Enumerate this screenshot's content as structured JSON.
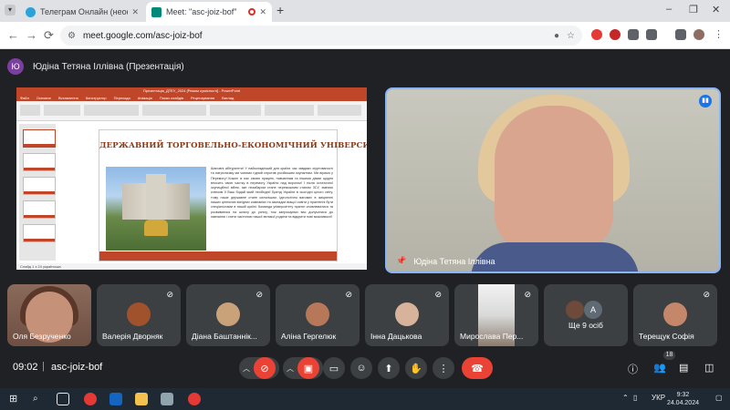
{
  "browser": {
    "tabs": [
      {
        "title": "Телеграм Онлайн (неофіційни",
        "active": false
      },
      {
        "title": "Meet: \"asc-joiz-bof\"",
        "active": true
      }
    ],
    "new_tab": "+",
    "window_controls": {
      "minimize": "–",
      "restore": "❐",
      "close": "✕"
    },
    "nav": {
      "back": "←",
      "forward": "→",
      "reload": "⟳"
    },
    "url": "meet.google.com/asc-joiz-bof"
  },
  "meet": {
    "presenter": {
      "avatar_letter": "Ю",
      "label": "Юдіна Тетяна Іллівна (Презентація)"
    },
    "slide": {
      "app_title": "Презентація_ДТЕУ_2024 [Режим сумісності] - PowerPoint",
      "menu": [
        "Файл",
        "Основне",
        "Вставлення",
        "Конструктор",
        "Переходи",
        "Анімація",
        "Показ слайдів",
        "Рецензування",
        "Вигляд"
      ],
      "heading": "ДЕРЖАВНИЙ ТОРГОВЕЛЬНО-ЕКОНОМІЧНИЙ УНІВЕРСИТЕТ",
      "body": "Шановні абітурієнти! У найскладніший для країни час завдяки згуртованості та патріотизму ми чинимо гідний спротив російським окупантам. Ми віримо у Перемогу! Кожен із нас своєю працею, навчанням та іншими діями щодня вносить свою частку в перемогу України над ворогом! І після остаточної окупаційної війни, яке незабаром стане переможним станом ЗСУ, змінюю ключові її Ваш бодай який необхідні! Бренд України в сьогодні цілого світу, тому наше державне стане сильнішим. Ідеологічно вагомих в зміцненні наших ціннісних вигідних компаніях та закладах вищої освіти у прагненні бути спеціалістами в нашій країні. Команда університету прагне оновлюватися та розвиватися на шляху до успіху, тож запрошуємо вас долучатися до навчання і стати частиною нашої великої родини та відкрити нові можливості!",
      "status": "Слайд 1 з 24    українська"
    },
    "speaker": {
      "name": "Юдіна Тетяна Іллівна"
    },
    "participants": [
      {
        "name": "Оля Безрученко"
      },
      {
        "name": "Валерія Дворняк"
      },
      {
        "name": "Діана Баштаннік..."
      },
      {
        "name": "Аліна Гергелюк"
      },
      {
        "name": "Інна Дацькова"
      },
      {
        "name": "Мирослава Пер..."
      },
      {
        "name": "Ще 9 осіб",
        "avatar_letter": "А"
      },
      {
        "name": "Терещук Софія"
      }
    ],
    "controls": {
      "time": "09:02",
      "separator": "|",
      "meeting_code": "asc-joiz-bof",
      "people_count": "18",
      "icons": {
        "mic_off": "mic-off-icon",
        "cam_off": "camera-off-icon",
        "captions": "captions-icon",
        "emoji": "emoji-icon",
        "present": "present-icon",
        "raise_hand": "hand-icon",
        "more": "more-icon",
        "leave": "hang-up-icon",
        "info": "info-icon",
        "people": "people-icon",
        "chat": "chat-icon",
        "activities": "activities-icon"
      }
    }
  },
  "taskbar": {
    "language": "УКР",
    "time": "9:32",
    "date": "24.04.2024"
  },
  "colors": {
    "meet_bg": "#202124",
    "tile_bg": "#3c4043",
    "danger": "#ea4335",
    "accent": "#8ab4f8",
    "slide_brand": "#c0462a"
  }
}
